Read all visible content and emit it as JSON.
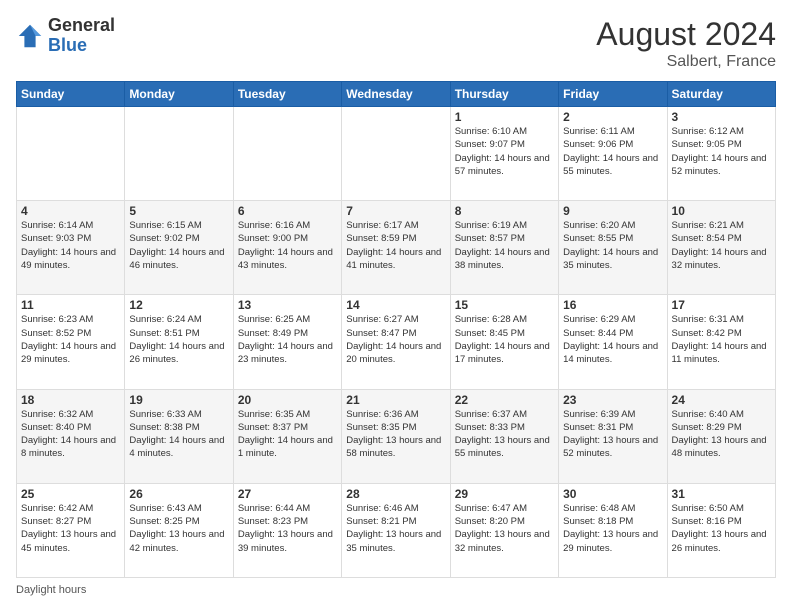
{
  "header": {
    "logo_general": "General",
    "logo_blue": "Blue",
    "title": "August 2024",
    "subtitle": "Salbert, France"
  },
  "days_of_week": [
    "Sunday",
    "Monday",
    "Tuesday",
    "Wednesday",
    "Thursday",
    "Friday",
    "Saturday"
  ],
  "weeks": [
    [
      {
        "day": "",
        "info": ""
      },
      {
        "day": "",
        "info": ""
      },
      {
        "day": "",
        "info": ""
      },
      {
        "day": "",
        "info": ""
      },
      {
        "day": "1",
        "info": "Sunrise: 6:10 AM\nSunset: 9:07 PM\nDaylight: 14 hours and 57 minutes."
      },
      {
        "day": "2",
        "info": "Sunrise: 6:11 AM\nSunset: 9:06 PM\nDaylight: 14 hours and 55 minutes."
      },
      {
        "day": "3",
        "info": "Sunrise: 6:12 AM\nSunset: 9:05 PM\nDaylight: 14 hours and 52 minutes."
      }
    ],
    [
      {
        "day": "4",
        "info": "Sunrise: 6:14 AM\nSunset: 9:03 PM\nDaylight: 14 hours and 49 minutes."
      },
      {
        "day": "5",
        "info": "Sunrise: 6:15 AM\nSunset: 9:02 PM\nDaylight: 14 hours and 46 minutes."
      },
      {
        "day": "6",
        "info": "Sunrise: 6:16 AM\nSunset: 9:00 PM\nDaylight: 14 hours and 43 minutes."
      },
      {
        "day": "7",
        "info": "Sunrise: 6:17 AM\nSunset: 8:59 PM\nDaylight: 14 hours and 41 minutes."
      },
      {
        "day": "8",
        "info": "Sunrise: 6:19 AM\nSunset: 8:57 PM\nDaylight: 14 hours and 38 minutes."
      },
      {
        "day": "9",
        "info": "Sunrise: 6:20 AM\nSunset: 8:55 PM\nDaylight: 14 hours and 35 minutes."
      },
      {
        "day": "10",
        "info": "Sunrise: 6:21 AM\nSunset: 8:54 PM\nDaylight: 14 hours and 32 minutes."
      }
    ],
    [
      {
        "day": "11",
        "info": "Sunrise: 6:23 AM\nSunset: 8:52 PM\nDaylight: 14 hours and 29 minutes."
      },
      {
        "day": "12",
        "info": "Sunrise: 6:24 AM\nSunset: 8:51 PM\nDaylight: 14 hours and 26 minutes."
      },
      {
        "day": "13",
        "info": "Sunrise: 6:25 AM\nSunset: 8:49 PM\nDaylight: 14 hours and 23 minutes."
      },
      {
        "day": "14",
        "info": "Sunrise: 6:27 AM\nSunset: 8:47 PM\nDaylight: 14 hours and 20 minutes."
      },
      {
        "day": "15",
        "info": "Sunrise: 6:28 AM\nSunset: 8:45 PM\nDaylight: 14 hours and 17 minutes."
      },
      {
        "day": "16",
        "info": "Sunrise: 6:29 AM\nSunset: 8:44 PM\nDaylight: 14 hours and 14 minutes."
      },
      {
        "day": "17",
        "info": "Sunrise: 6:31 AM\nSunset: 8:42 PM\nDaylight: 14 hours and 11 minutes."
      }
    ],
    [
      {
        "day": "18",
        "info": "Sunrise: 6:32 AM\nSunset: 8:40 PM\nDaylight: 14 hours and 8 minutes."
      },
      {
        "day": "19",
        "info": "Sunrise: 6:33 AM\nSunset: 8:38 PM\nDaylight: 14 hours and 4 minutes."
      },
      {
        "day": "20",
        "info": "Sunrise: 6:35 AM\nSunset: 8:37 PM\nDaylight: 14 hours and 1 minute."
      },
      {
        "day": "21",
        "info": "Sunrise: 6:36 AM\nSunset: 8:35 PM\nDaylight: 13 hours and 58 minutes."
      },
      {
        "day": "22",
        "info": "Sunrise: 6:37 AM\nSunset: 8:33 PM\nDaylight: 13 hours and 55 minutes."
      },
      {
        "day": "23",
        "info": "Sunrise: 6:39 AM\nSunset: 8:31 PM\nDaylight: 13 hours and 52 minutes."
      },
      {
        "day": "24",
        "info": "Sunrise: 6:40 AM\nSunset: 8:29 PM\nDaylight: 13 hours and 48 minutes."
      }
    ],
    [
      {
        "day": "25",
        "info": "Sunrise: 6:42 AM\nSunset: 8:27 PM\nDaylight: 13 hours and 45 minutes."
      },
      {
        "day": "26",
        "info": "Sunrise: 6:43 AM\nSunset: 8:25 PM\nDaylight: 13 hours and 42 minutes."
      },
      {
        "day": "27",
        "info": "Sunrise: 6:44 AM\nSunset: 8:23 PM\nDaylight: 13 hours and 39 minutes."
      },
      {
        "day": "28",
        "info": "Sunrise: 6:46 AM\nSunset: 8:21 PM\nDaylight: 13 hours and 35 minutes."
      },
      {
        "day": "29",
        "info": "Sunrise: 6:47 AM\nSunset: 8:20 PM\nDaylight: 13 hours and 32 minutes."
      },
      {
        "day": "30",
        "info": "Sunrise: 6:48 AM\nSunset: 8:18 PM\nDaylight: 13 hours and 29 minutes."
      },
      {
        "day": "31",
        "info": "Sunrise: 6:50 AM\nSunset: 8:16 PM\nDaylight: 13 hours and 26 minutes."
      }
    ]
  ],
  "footer": {
    "note": "Daylight hours"
  }
}
